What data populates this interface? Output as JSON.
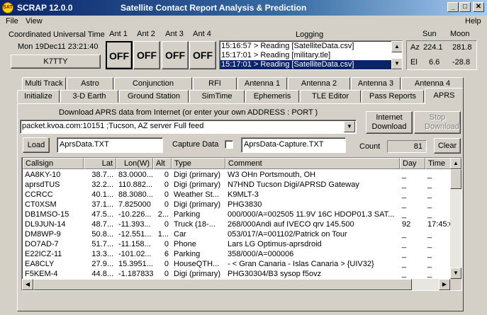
{
  "window": {
    "app_name": "SCRAP  12.0.0",
    "caption": "Satellite Contact Report Analysis & Prediction",
    "icon_text": "SAT",
    "min_glyph": "_",
    "max_glyph": "□",
    "close_glyph": "✕"
  },
  "menu": {
    "file": "File",
    "view": "View",
    "help": "Help"
  },
  "utc": {
    "label": "Coordinated Universal Time",
    "value": "Mon 19Dec11 23:21:40",
    "callsign": "K7TTY"
  },
  "antennas": [
    {
      "label": "Ant 1",
      "state": "OFF"
    },
    {
      "label": "Ant 2",
      "state": "OFF"
    },
    {
      "label": "Ant 3",
      "state": "OFF"
    },
    {
      "label": "Ant 4",
      "state": "OFF"
    }
  ],
  "logging": {
    "label": "Logging",
    "lines": [
      "15:16:57 > Reading [SatelliteData.csv]",
      "15:17:01 > Reading [military.tle]",
      "15:17:01 > Reading [SatelliteData.csv]"
    ],
    "selected_index": 2
  },
  "sunmoon": {
    "sun_label": "Sun",
    "moon_label": "Moon",
    "az_label": "Az",
    "el_label": "El",
    "sun_az": "224.1",
    "moon_az": "281.8",
    "sun_el": "6.6",
    "moon_el": "-28.8"
  },
  "tabs_row1": [
    "Multi Track",
    "Astro",
    "Conjunction",
    "RFI",
    "Antenna 1",
    "Antenna 2",
    "Antenna 3",
    "Antenna 4"
  ],
  "tabs_row2": [
    "Initialize",
    "3-D Earth",
    "Ground Station",
    "SimTime",
    "Ephemeris",
    "TLE Editor",
    "Pass Reports",
    "APRS"
  ],
  "active_tab": "APRS",
  "aprs": {
    "download_label": "Download APRS data from Internet (or enter your own ADDRESS : PORT )",
    "server": "packet.kvoa.com:10151 ;Tucson, AZ server Full feed",
    "internet_download": "Internet Download",
    "stop_download": "Stop Download",
    "load_label": "Load",
    "load_file": "AprsData.TXT",
    "capture_label": "Capture Data",
    "capture_checked": false,
    "capture_file": "AprsData-Capture.TXT",
    "count_label": "Count",
    "count": "81",
    "clear_label": "Clear"
  },
  "table": {
    "columns": [
      "Callsign",
      "Lat",
      "Lon(W)",
      "Alt",
      "Type",
      "Comment",
      "Day",
      "Time"
    ],
    "rows": [
      [
        "AA8KY-10",
        "38.7...",
        "83.0000...",
        "0",
        "Digi (primary)",
        "W3 OHn Portsmouth, OH",
        "_",
        "_"
      ],
      [
        "aprsdTUS",
        "32.2...",
        "110.882...",
        "0",
        "Digi (primary)",
        "N7HND Tucson Digi/APRSD Gateway",
        "_",
        "_"
      ],
      [
        "CCRCC",
        "40.1...",
        "88.3080...",
        "0",
        "Weather St...",
        "K9MLT-3",
        "_",
        "_"
      ],
      [
        "CT0XSM",
        "37.1...",
        "7.825000",
        "0",
        "Digi (primary)",
        "PHG3830",
        "_",
        "_"
      ],
      [
        "DB1MSO-15",
        "47.5...",
        "-10.226...",
        "2...",
        "Parking",
        "000/000/A=002505 11.9V 16C HDOP01.3 SAT...",
        "_",
        "_"
      ],
      [
        "DL9JUN-14",
        "48.7...",
        "-11.393...",
        "0",
        "Truck (18-...",
        "268/000Andi auf IVECO qrv 145.500",
        "92",
        "17:45:0"
      ],
      [
        "DM8WP-9",
        "50.8...",
        "-12.551...",
        "1...",
        "Car",
        "053/017/A=001102/Patrick on Tour",
        "_",
        "_"
      ],
      [
        "DO7AD-7",
        "51.7...",
        "-11.158...",
        "0",
        "Phone",
        "Lars LG Optimus-aprsdroid",
        "_",
        "_"
      ],
      [
        "E22ICZ-11",
        "13.3...",
        "-101.02...",
        "6",
        "Parking",
        "358/000/A=000006",
        "_",
        "_"
      ],
      [
        "EA8CLY",
        "27.9...",
        "15.3951...",
        "0",
        "HouseQTH...",
        "- < Gran Canaria - Islas Canaria > {UIV32}",
        "_",
        "_"
      ],
      [
        "F5KEM-4",
        "44.8...",
        "-1.187833",
        "0",
        "Digi (primary)",
        "PHG30304/B3 sysop f5ovz",
        "_",
        "_"
      ]
    ]
  }
}
